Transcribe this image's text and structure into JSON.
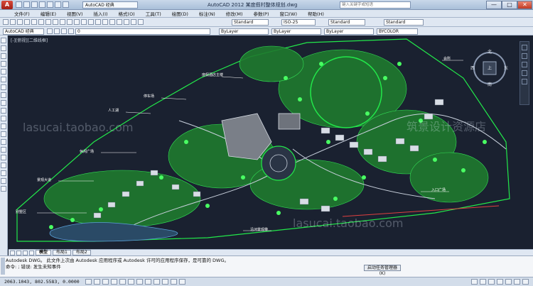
{
  "window": {
    "app_letter": "A",
    "workspace": "AutoCAD 经典",
    "title": "AutoCAD 2012    某度假村整体规划.dwg",
    "search_placeholder": "键入关键字或短语",
    "controls": [
      "—",
      "□",
      "✕"
    ]
  },
  "menubar": {
    "items": [
      "文件(F)",
      "编辑(E)",
      "视图(V)",
      "插入(I)",
      "格式(O)",
      "工具(T)",
      "绘图(D)",
      "标注(N)",
      "修改(M)",
      "参数(P)",
      "窗口(W)",
      "帮助(H)"
    ]
  },
  "toolbar": {
    "text_style": "Standard",
    "dim_style": "ISO-25",
    "table_style": "Standard",
    "mleader_style": "Standard",
    "workspace_combo": "AutoCAD 经典",
    "layer_combo": "0",
    "color": "ByLayer",
    "linetype": "ByLayer",
    "lineweight": "ByLayer",
    "plot_style": "BYCOLOR"
  },
  "canvas": {
    "viewport_label": "[-][俯视][二维线框]",
    "compass": {
      "n": "北",
      "s": "南",
      "e": "东",
      "w": "西",
      "center": "上"
    },
    "annotations": [
      "度假酒店主楼",
      "停车场",
      "人工湖",
      "休闲广场",
      "景观大道",
      "别墅区",
      "会所",
      "入口广场",
      "沿河景观带"
    ]
  },
  "layout_tabs": [
    "模型",
    "布局1",
    "布局2"
  ],
  "command": {
    "line1": "Autodesk DWG。  此文件上次由 Autodesk 应用程序或 Autodesk 许可的应用程序保存，是可靠的 DWG。",
    "line2": "命令: ; 错误: 发生未知事件",
    "task_button": "启动任务管理器(K)"
  },
  "status": {
    "coordinates": "2063.1043, 802.5583, 0.0000"
  },
  "watermarks": [
    "lasucai.taobao.com",
    "筑景设计资源店"
  ],
  "colors": {
    "drawing_bg": "#1a2130",
    "linework": "#22e84a",
    "annotation": "#ffffff",
    "accent": "#c23a22"
  }
}
